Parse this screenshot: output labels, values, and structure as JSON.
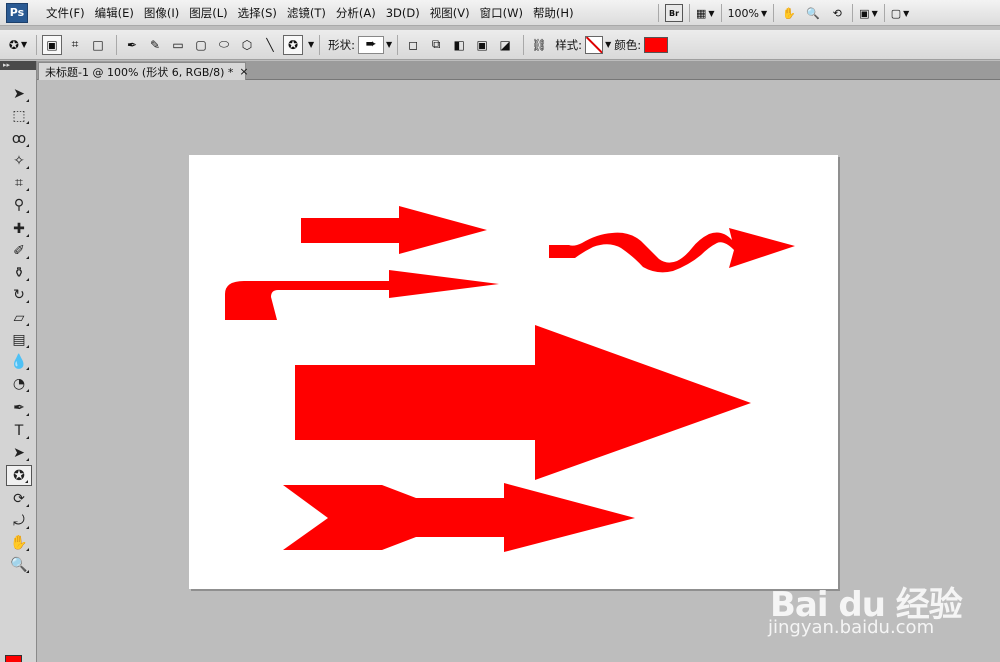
{
  "app": {
    "logo": "Ps"
  },
  "menu": [
    "文件(F)",
    "编辑(E)",
    "图像(I)",
    "图层(L)",
    "选择(S)",
    "滤镜(T)",
    "分析(A)",
    "3D(D)",
    "视图(V)",
    "窗口(W)",
    "帮助(H)"
  ],
  "appbar": {
    "bridge": "Br",
    "zoom": "100%"
  },
  "options": {
    "shape_label": "形状:",
    "style_label": "样式:",
    "color_label": "颜色:",
    "color": "#ff0000"
  },
  "document": {
    "tab_title": "未标题-1 @ 100% (形状 6, RGB/8) *",
    "tab_close": "×"
  },
  "colors": {
    "foreground": "#ff0000",
    "background": "#ffffff",
    "canvas": "#ffffff"
  },
  "watermark": {
    "logo": "Bai du 经验",
    "url": "jingyan.baidu.com"
  },
  "icons": {
    "toolbox": [
      "move-icon",
      "marquee-icon",
      "lasso-icon",
      "magic-wand-icon",
      "crop-icon",
      "eyedropper-icon",
      "healing-brush-icon",
      "brush-icon",
      "clone-stamp-icon",
      "history-brush-icon",
      "eraser-icon",
      "gradient-icon",
      "blur-icon",
      "dodge-icon",
      "pen-icon",
      "type-icon",
      "path-select-icon",
      "custom-shape-icon",
      "3d-rotate-icon",
      "3d-orbit-icon",
      "hand-icon",
      "zoom-icon"
    ]
  }
}
